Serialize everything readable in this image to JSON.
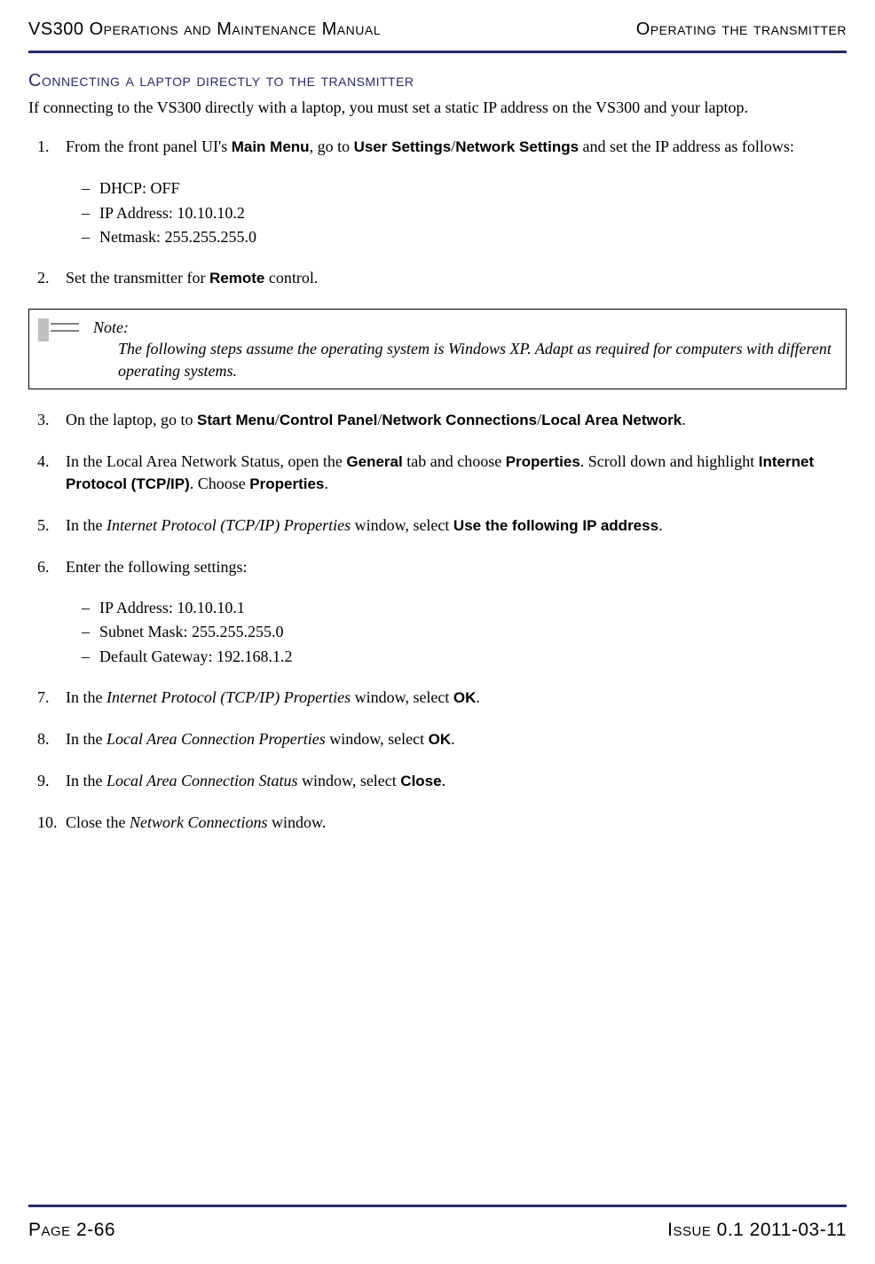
{
  "header": {
    "left": "VS300 Operations and Maintenance Manual",
    "right": "Operating the transmitter"
  },
  "section_title": "Connecting a laptop directly to the transmitter",
  "intro": "If connecting to the VS300 directly with a laptop, you must set a static IP address on the VS300 and your laptop.",
  "steps": {
    "s1_pre": "From the front panel UI's ",
    "s1_b1": "Main Menu",
    "s1_mid1": ", go to ",
    "s1_b2": "User Settings",
    "s1_sep1": "/",
    "s1_b3": "Network Settings",
    "s1_post": " and set the IP address as follows:",
    "s1_sub": [
      "DHCP: OFF",
      "IP Address: 10.10.10.2",
      "Netmask: 255.255.255.0"
    ],
    "s2_pre": "Set the transmitter for ",
    "s2_b1": "Remote",
    "s2_post": " control.",
    "s3_pre": "On the laptop, go to ",
    "s3_b1": "Start Menu",
    "s3_b2": "Control Panel",
    "s3_b3": "Network Connections",
    "s3_b4": "Local Area Network",
    "s3_sep": "/",
    "s3_post": ".",
    "s4_pre": "In the Local Area Network Status, open the ",
    "s4_b1": "General",
    "s4_mid1": " tab and choose ",
    "s4_b2": "Properties",
    "s4_mid2": ". Scroll down and highlight ",
    "s4_b3": "Internet Protocol (TCP/IP)",
    "s4_mid3": ". Choose ",
    "s4_b4": "Properties",
    "s4_post": ".",
    "s5_pre": "In the ",
    "s5_i1": "Internet Protocol (TCP/IP) Properties",
    "s5_mid": " window, select ",
    "s5_b1": "Use the following IP address",
    "s5_post": ".",
    "s6": "Enter the following settings:",
    "s6_sub": [
      "IP Address: 10.10.10.1",
      "Subnet Mask: 255.255.255.0",
      "Default Gateway: 192.168.1.2"
    ],
    "s7_pre": "In the ",
    "s7_i1": "Internet Protocol (TCP/IP) Properties",
    "s7_mid": " window, select ",
    "s7_b1": "OK",
    "s7_post": ".",
    "s8_pre": "In the ",
    "s8_i1": "Local Area Connection Properties",
    "s8_mid": " window, select ",
    "s8_b1": "OK",
    "s8_post": ".",
    "s9_pre": "In the ",
    "s9_i1": "Local Area Connection Status",
    "s9_mid": " window, select ",
    "s9_b1": "Close",
    "s9_post": ".",
    "s10_pre": "Close the ",
    "s10_i1": "Network Connections",
    "s10_post": " window."
  },
  "note": {
    "title": "Note:",
    "body": "The following steps assume the operating system is Windows XP. Adapt as required for computers with different operating systems."
  },
  "footer": {
    "left": "Page 2-66",
    "right": "Issue 0.1  2011-03-11"
  }
}
